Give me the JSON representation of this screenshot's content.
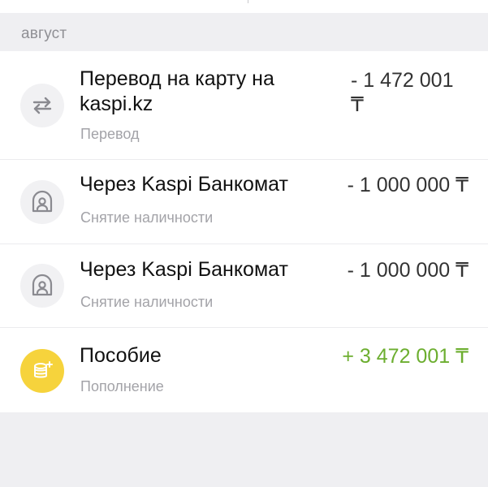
{
  "section": {
    "month_label": "август"
  },
  "transactions": [
    {
      "title": "Перевод на карту на kaspi.kz",
      "category": "Перевод",
      "amount": "- 1 472 001 ₸",
      "icon": "transfer-arrows-icon"
    },
    {
      "title": "Через Kaspi Банкомат",
      "category": "Снятие наличности",
      "amount": "- 1 000 000 ₸",
      "icon": "atm-person-icon"
    },
    {
      "title": "Через Kaspi Банкомат",
      "category": "Снятие наличности",
      "amount": "- 1 000 000 ₸",
      "icon": "atm-person-icon"
    },
    {
      "title": "Пособие",
      "category": "Пополнение",
      "amount": "+ 3 472 001 ₸",
      "icon": "coins-stack-icon"
    }
  ],
  "colors": {
    "background": "#efeff2",
    "row_background": "#ffffff",
    "amount_negative": "#333333",
    "amount_positive": "#6cae2f",
    "coins_icon_bg": "#f6d33c",
    "muted_text": "#a3a3a8"
  }
}
